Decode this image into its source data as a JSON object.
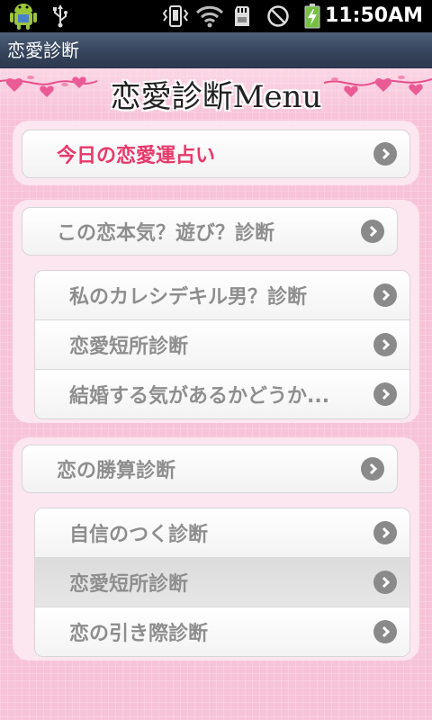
{
  "status_bar": {
    "time": "11:50AM",
    "icons": [
      "android-icon",
      "usb-icon",
      "vibrate-icon",
      "wifi-icon",
      "sdcard-icon",
      "no-sim-icon",
      "battery-charging-icon"
    ]
  },
  "app_title": "恋愛診断",
  "menu_title": "恋愛診断Menu",
  "panel1": {
    "button": "今日の恋愛運占い"
  },
  "panel2": {
    "header": "この恋本気？遊び？診断",
    "items": [
      {
        "label": "私のカレシデキル男？診断"
      },
      {
        "label": "恋愛短所診断"
      },
      {
        "label": "結婚する気があるかどうか..."
      }
    ]
  },
  "panel3": {
    "header": "恋の勝算診断",
    "items": [
      {
        "label": "自信のつく診断"
      },
      {
        "label": "恋愛短所診断"
      },
      {
        "label": "恋の引き際診断"
      }
    ]
  },
  "colors": {
    "accent_pink": "#e8386a",
    "background": "#f7c3d8",
    "title_bar": "#3a4862"
  }
}
